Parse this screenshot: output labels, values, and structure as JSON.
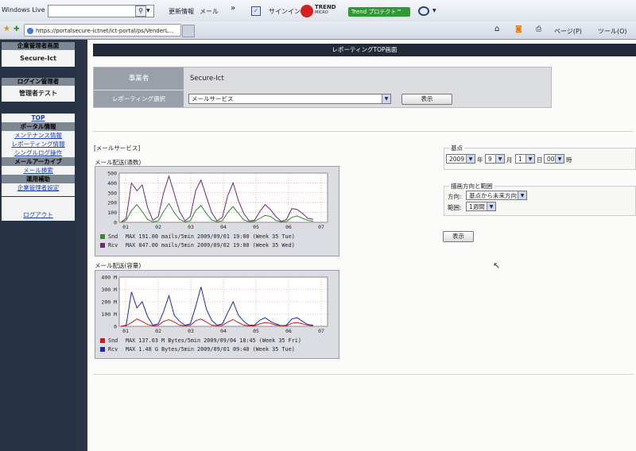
{
  "browser": {
    "windows_live_label": "Windows Live",
    "update_info": "更新情報",
    "mail": "メール",
    "chevrons": "»",
    "signin": "サインイン",
    "trend_logo": "TREND",
    "trend_logo_sub": "MICRO",
    "trend_button": "Trend プロテクト™",
    "tab_url": "https://portalsecure-ictnet/ict-portal/ps/VenderL...",
    "page_menu": "ページ(P)",
    "tools_menu": "ツール(O)"
  },
  "sidebar": {
    "company_admin_header": "企業管理者画面",
    "company_name": "Secure-Ict",
    "login_admin_header": "ログイン管理者",
    "admin_name": "管理者テスト",
    "menu": [
      {
        "type": "link",
        "label": "TOP"
      },
      {
        "type": "section",
        "label": "ポータル情報"
      },
      {
        "type": "link",
        "label": "メンテナンス情報"
      },
      {
        "type": "link",
        "label": "レポーティング情報"
      },
      {
        "type": "link",
        "label": "シングルログ操作"
      },
      {
        "type": "section",
        "label": "メールアーカイブ"
      },
      {
        "type": "link",
        "label": "メール検索"
      },
      {
        "type": "section",
        "label": "運用補助"
      },
      {
        "type": "link",
        "label": "企業管理者設定"
      }
    ],
    "logout": "ログアウト"
  },
  "main": {
    "page_title": "レポーティングTOP画面",
    "business_label": "事業者",
    "business_value": "Secure-Ict",
    "reporting_select_label": "レポーティング選択",
    "reporting_select_value": "メールサービス",
    "display_button": "表示",
    "section_label": "[メールサービス]",
    "chart1_caption": "メール配送(通数)",
    "chart2_caption": "メール配送(容量)",
    "chart1_legend": [
      {
        "name": "Snd",
        "color": "#2e8b2e",
        "text": "MAX  191.00    mails/5min   2009/09/01 19:00 (Week 35 Tue)"
      },
      {
        "name": "Rcv",
        "color": "#6b2a7a",
        "text": "MAX  847.00    mails/5min   2009/09/02 19:00 (Week 35 Wed)"
      }
    ],
    "chart2_legend": [
      {
        "name": "Snd",
        "color": "#d01818",
        "text": "MAX  137.03 M Bytes/5min   2009/09/04 18:45 (Week 35 Fri)"
      },
      {
        "name": "Rcv",
        "color": "#1a2ab0",
        "text": "MAX    1.48 G Bytes/5min   2009/09/01 09:40 (Week 35 Tue)"
      }
    ],
    "base_point": {
      "title": "基点",
      "year": "2009",
      "year_unit": "年",
      "month": "9",
      "month_unit": "月",
      "day": "1",
      "day_unit": "日",
      "hour": "00",
      "hour_unit": "時"
    },
    "direction": {
      "title": "描画方向と範囲",
      "direction_label": "方向:",
      "direction_value": "基点から未来方向",
      "range_label": "範囲:",
      "range_value": "1週間"
    },
    "display_button2": "表示"
  },
  "chart_data": [
    {
      "type": "line",
      "caption": "メール配送(通数)",
      "x_ticks": [
        "01",
        "02",
        "03",
        "04",
        "05",
        "06",
        "07"
      ],
      "y_ticks": [
        "0",
        "100",
        "200",
        "300",
        "400",
        "500"
      ],
      "ylim": [
        0,
        500
      ],
      "series": [
        {
          "name": "Snd",
          "color": "#2e8b2e",
          "values": [
            0,
            20,
            120,
            180,
            110,
            30,
            5,
            15,
            110,
            190,
            100,
            30,
            5,
            15,
            120,
            170,
            90,
            25,
            5,
            15,
            100,
            160,
            90,
            25,
            5,
            10,
            40,
            70,
            60,
            20,
            5,
            10,
            50,
            65,
            40,
            20,
            10
          ]
        },
        {
          "name": "Rcv",
          "color": "#6b2a7a",
          "values": [
            0,
            40,
            400,
            320,
            380,
            150,
            20,
            60,
            300,
            470,
            290,
            110,
            15,
            60,
            320,
            430,
            260,
            100,
            15,
            50,
            270,
            400,
            220,
            90,
            15,
            20,
            110,
            180,
            130,
            60,
            10,
            30,
            140,
            130,
            90,
            40,
            30
          ]
        }
      ]
    },
    {
      "type": "line",
      "caption": "メール配送(容量)",
      "x_ticks": [
        "01",
        "02",
        "03",
        "04",
        "05",
        "06",
        "07"
      ],
      "y_ticks": [
        "0",
        "100 M",
        "200 M",
        "300 M",
        "400 M"
      ],
      "ylim": [
        0,
        400
      ],
      "series": [
        {
          "name": "Snd",
          "color": "#d01818",
          "values": [
            0,
            5,
            30,
            60,
            40,
            15,
            5,
            8,
            40,
            55,
            35,
            10,
            5,
            8,
            45,
            60,
            35,
            10,
            5,
            8,
            35,
            55,
            30,
            10,
            5,
            5,
            20,
            30,
            25,
            10,
            5,
            5,
            25,
            30,
            20,
            10,
            5
          ]
        },
        {
          "name": "Rcv",
          "color": "#1a2ab0",
          "values": [
            0,
            10,
            280,
            150,
            200,
            80,
            10,
            20,
            120,
            250,
            90,
            40,
            10,
            20,
            160,
            320,
            140,
            50,
            10,
            20,
            110,
            200,
            90,
            40,
            10,
            10,
            50,
            70,
            40,
            20,
            5,
            10,
            60,
            70,
            40,
            15,
            10
          ]
        }
      ]
    }
  ]
}
